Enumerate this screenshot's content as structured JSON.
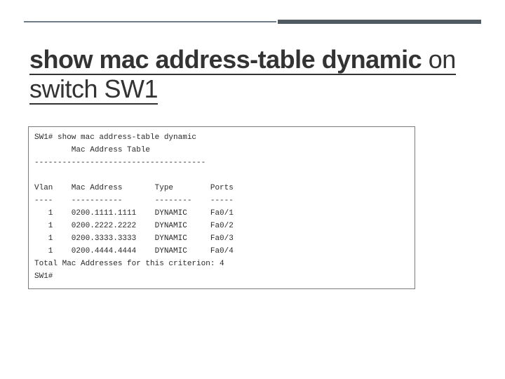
{
  "title": {
    "bold_part": "show mac address-table dynamic",
    "rest_part": " on switch SW1"
  },
  "terminal": {
    "prompt_cmd": "SW1# show mac address-table dynamic",
    "subheader": "        Mac Address Table",
    "separator1": "-------------------------------------",
    "col_header": "Vlan    Mac Address       Type        Ports",
    "col_under": "----    -----------       --------    -----",
    "footer": "Total Mac Addresses for this criterion: 4",
    "final_prompt": "SW1#",
    "entries": [
      {
        "vlan": "1",
        "mac": "0200.1111.1111",
        "type": "DYNAMIC",
        "port": "Fa0/1"
      },
      {
        "vlan": "1",
        "mac": "0200.2222.2222",
        "type": "DYNAMIC",
        "port": "Fa0/2"
      },
      {
        "vlan": "1",
        "mac": "0200.3333.3333",
        "type": "DYNAMIC",
        "port": "Fa0/3"
      },
      {
        "vlan": "1",
        "mac": "0200.4444.4444",
        "type": "DYNAMIC",
        "port": "Fa0/4"
      }
    ]
  },
  "chart_data": {
    "type": "table",
    "title": "Mac Address Table",
    "columns": [
      "Vlan",
      "Mac Address",
      "Type",
      "Ports"
    ],
    "rows": [
      [
        "1",
        "0200.1111.1111",
        "DYNAMIC",
        "Fa0/1"
      ],
      [
        "1",
        "0200.2222.2222",
        "DYNAMIC",
        "Fa0/2"
      ],
      [
        "1",
        "0200.3333.3333",
        "DYNAMIC",
        "Fa0/3"
      ],
      [
        "1",
        "0200.4444.4444",
        "DYNAMIC",
        "Fa0/4"
      ]
    ],
    "summary": "Total Mac Addresses for this criterion: 4"
  }
}
